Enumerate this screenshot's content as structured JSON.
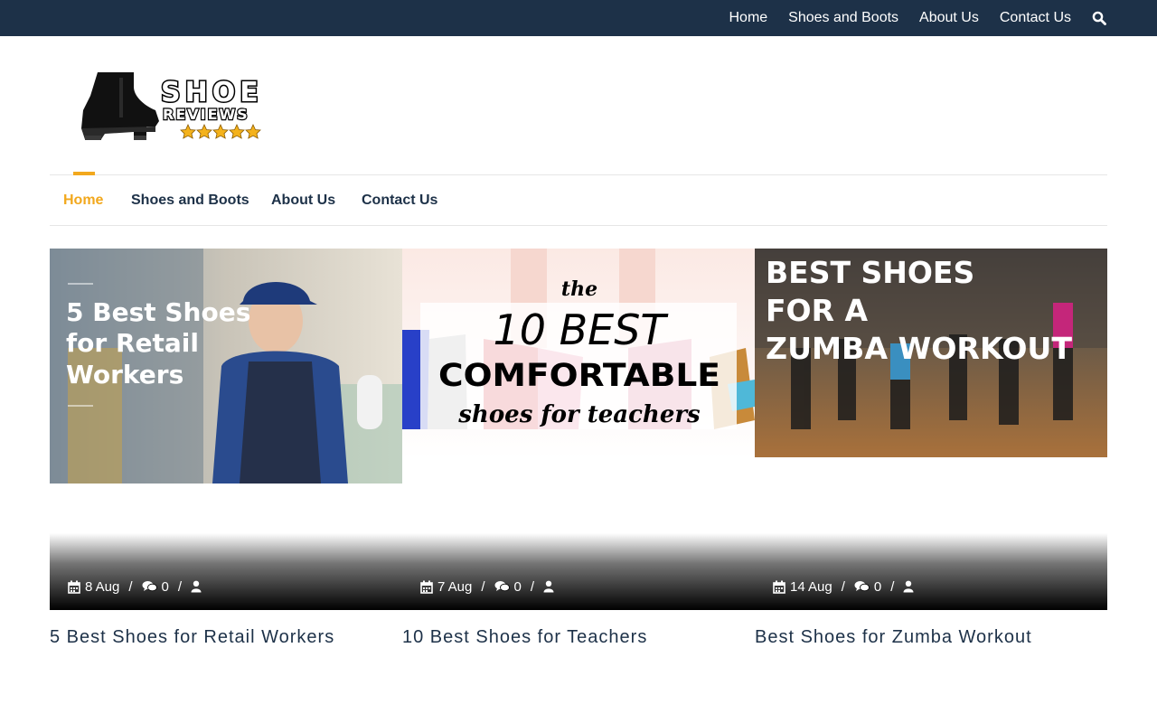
{
  "topbar": {
    "links": [
      "Home",
      "Shoes and Boots",
      "About Us",
      "Contact Us"
    ],
    "icon": "search-icon"
  },
  "logo": {
    "line1": "SHOE",
    "line2": "REVIEWS"
  },
  "mainnav": {
    "items": [
      "Home",
      "Shoes and Boots",
      "About Us",
      "Contact Us"
    ],
    "active": "Home",
    "accent_color": "#f2a81d"
  },
  "posts": [
    {
      "image_text": [
        "5 Best Shoes",
        "for Retail",
        "Workers"
      ],
      "date": "8 Aug",
      "comments": "0",
      "title": "5 Best Shoes for Retail Workers"
    },
    {
      "image_text": [
        "the",
        "10 BEST",
        "COMFORTABLE",
        "shoes for teachers"
      ],
      "date": "7 Aug",
      "comments": "0",
      "title": "10 Best Shoes for Teachers"
    },
    {
      "image_text": [
        "BEST SHOES",
        "FOR A",
        "ZUMBA WORKOUT"
      ],
      "date": "14 Aug",
      "comments": "0",
      "title": "Best Shoes for Zumba Workout"
    }
  ],
  "colors": {
    "topbar": "#1d3148",
    "text": "#1d3148",
    "accent": "#f2a81d"
  }
}
